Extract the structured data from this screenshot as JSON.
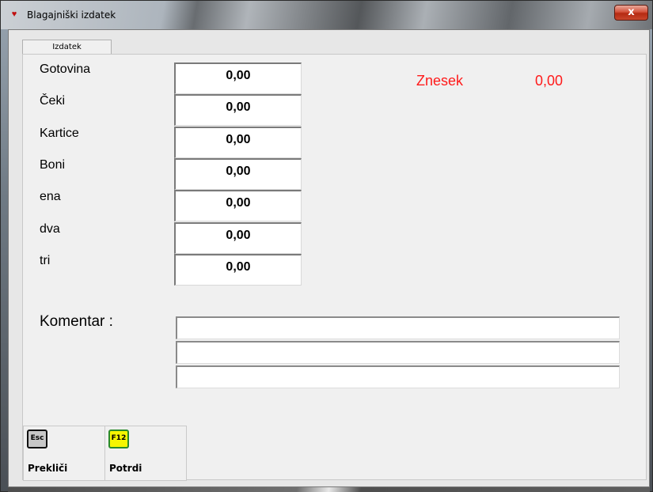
{
  "window": {
    "title": "Blagajniški izdatek",
    "close_glyph": "x",
    "app_icon": "app-icon"
  },
  "tabs": [
    {
      "label": "Izdatek",
      "active": true
    }
  ],
  "payments": [
    {
      "label": "Gotovina",
      "value": "0,00"
    },
    {
      "label": "Čeki",
      "value": "0,00"
    },
    {
      "label": "Kartice",
      "value": "0,00"
    },
    {
      "label": "Boni",
      "value": "0,00"
    },
    {
      "label": "ena",
      "value": "0,00"
    },
    {
      "label": "dva",
      "value": "0,00"
    },
    {
      "label": "tri",
      "value": "0,00"
    }
  ],
  "total": {
    "label": "Znesek",
    "value": "0,00",
    "color": "#ff1a1a"
  },
  "comment": {
    "label": "Komentar :",
    "lines": [
      "",
      "",
      ""
    ]
  },
  "buttons": [
    {
      "key": "Esc",
      "label": "Prekliči",
      "key_color": "#c8c8c8",
      "icon": "esc-key-icon"
    },
    {
      "key": "F12",
      "label": "Potrdi",
      "key_color": "#f5f500",
      "icon": "f12-key-icon"
    }
  ]
}
